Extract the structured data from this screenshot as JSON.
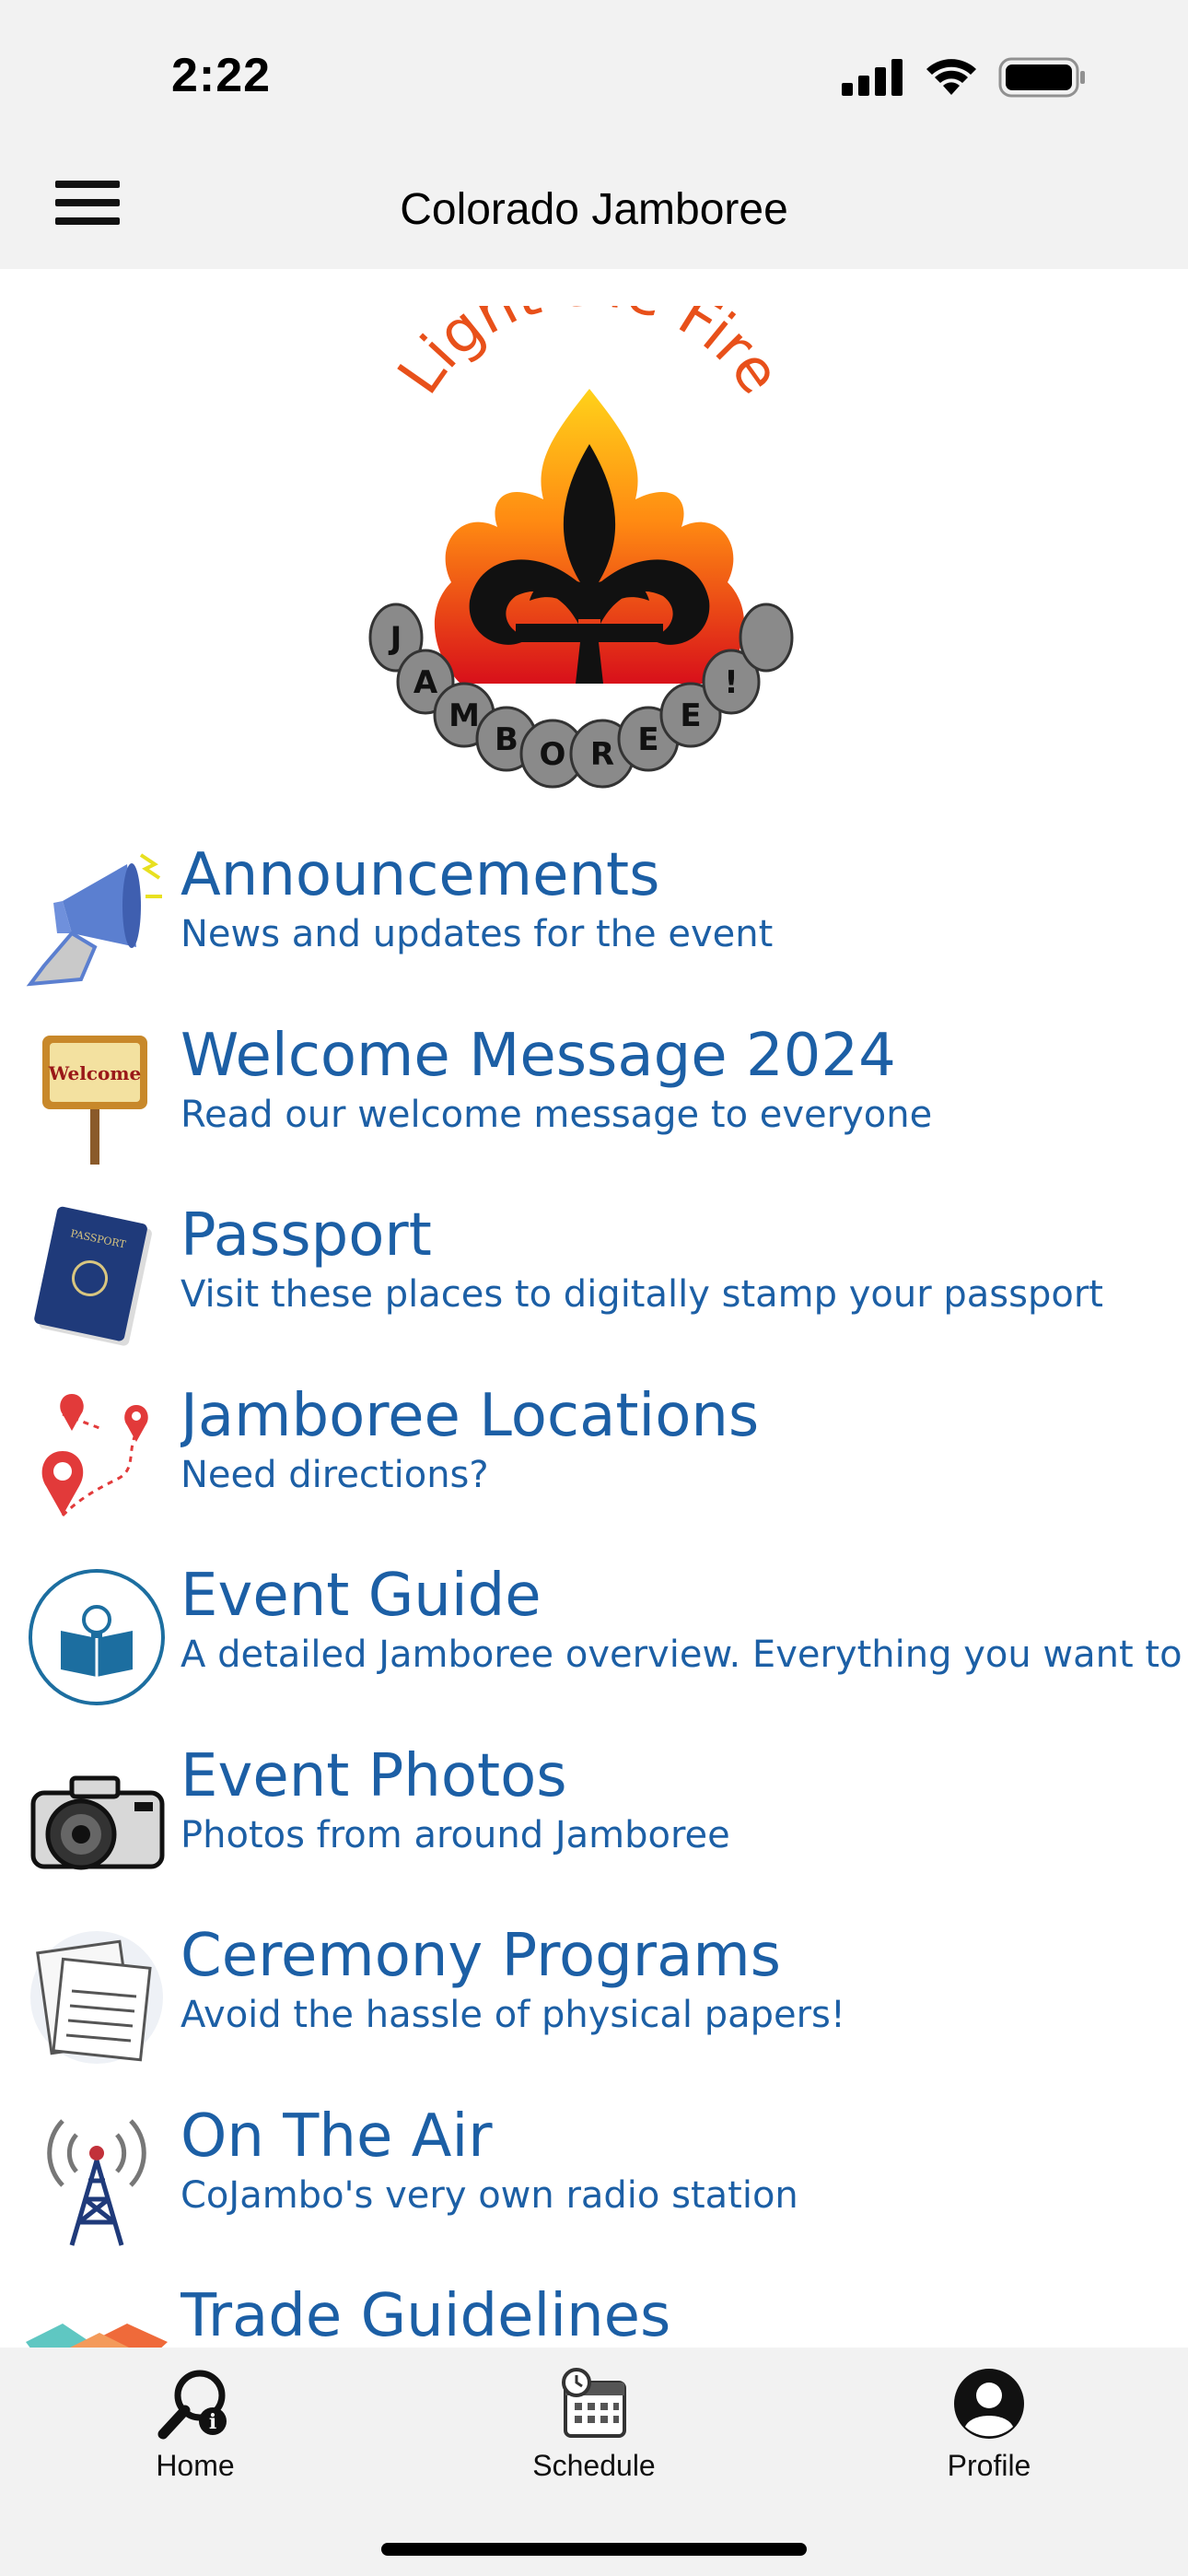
{
  "status": {
    "time": "2:22"
  },
  "nav": {
    "title": "Colorado Jamboree"
  },
  "logo": {
    "arc_text": "Light the Fire",
    "stones": [
      "J",
      "A",
      "M",
      "B",
      "O",
      "R",
      "E",
      "E",
      "!"
    ]
  },
  "menu": [
    {
      "title": "Announcements",
      "subtitle": "News and updates for the event",
      "icon": "megaphone-icon"
    },
    {
      "title": "Welcome Message 2024",
      "subtitle": "Read our welcome message to everyone",
      "icon": "welcome-sign-icon",
      "sign_text": "Welcome"
    },
    {
      "title": "Passport",
      "subtitle": "Visit these places to digitally stamp your passport",
      "icon": "passport-icon",
      "cover_text": "PASSPORT"
    },
    {
      "title": "Jamboree Locations",
      "subtitle": "Need directions?",
      "icon": "map-pins-icon"
    },
    {
      "title": "Event Guide",
      "subtitle": "A detailed Jamboree overview. Everything you want to know",
      "icon": "guide-book-icon"
    },
    {
      "title": "Event Photos",
      "subtitle": "Photos from around Jamboree",
      "icon": "camera-icon"
    },
    {
      "title": "Ceremony Programs",
      "subtitle": "Avoid the hassle of physical papers!",
      "icon": "papers-icon"
    },
    {
      "title": "On The Air",
      "subtitle": "CoJambo's very own radio station",
      "icon": "radio-tower-icon"
    },
    {
      "title": "Trade Guidelines",
      "subtitle": "",
      "icon": "handshake-icon"
    }
  ],
  "tabs": [
    {
      "label": "Home",
      "icon": "home-search-icon"
    },
    {
      "label": "Schedule",
      "icon": "schedule-calendar-icon"
    },
    {
      "label": "Profile",
      "icon": "profile-icon"
    }
  ],
  "colors": {
    "accent": "#1c5fa5",
    "bar_bg": "#f2f2f2"
  }
}
